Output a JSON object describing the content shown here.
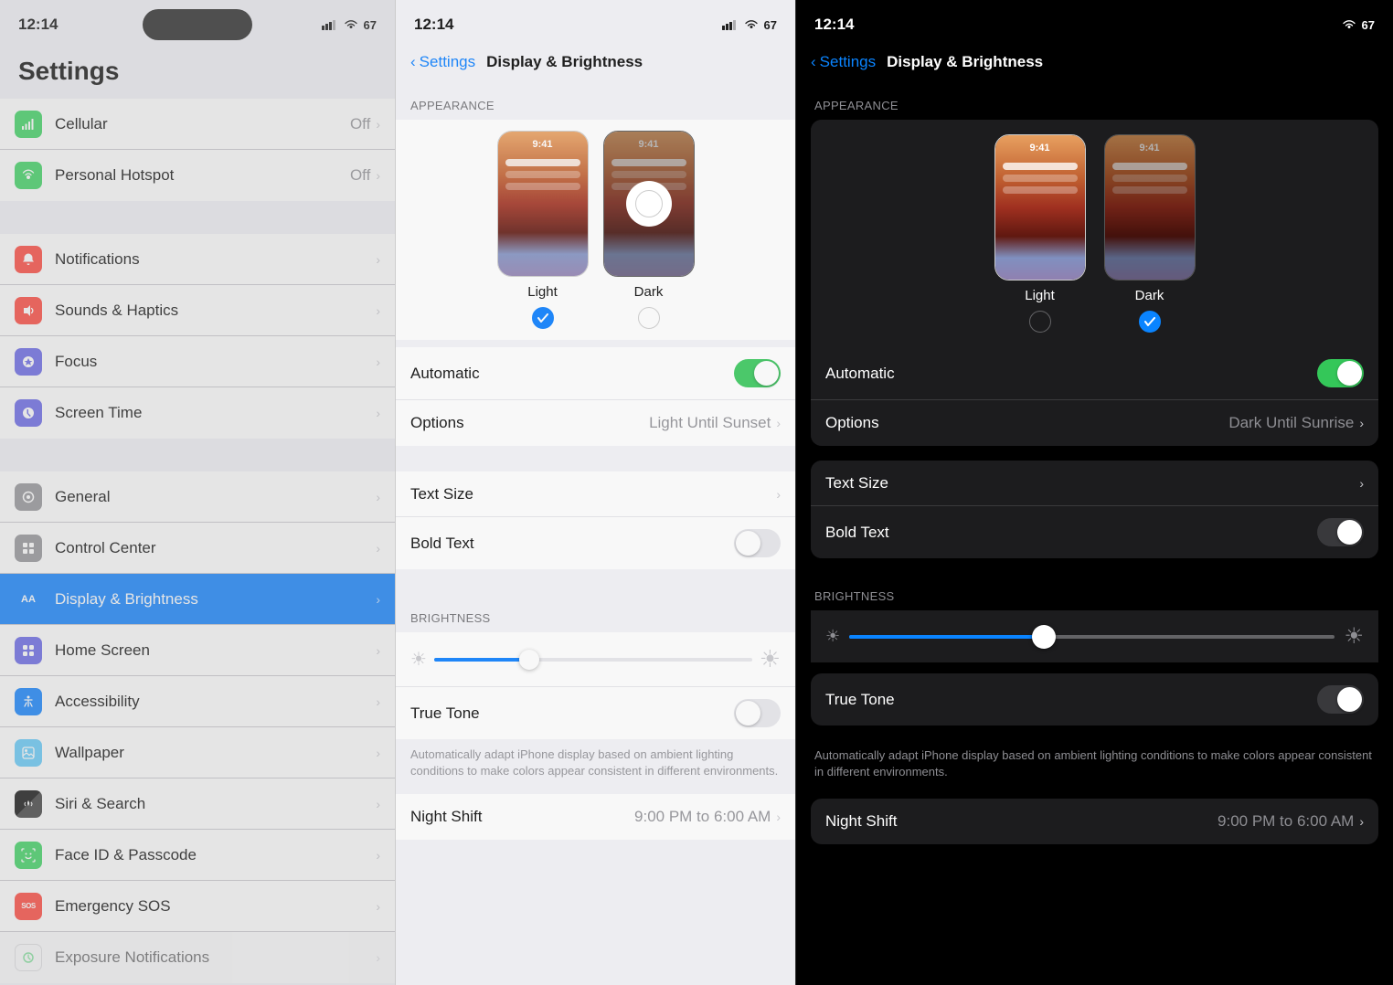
{
  "panel1": {
    "status_time": "12:14",
    "title": "Settings",
    "groups": [
      {
        "items": [
          {
            "id": "cellular",
            "label": "Cellular",
            "value": "Off",
            "icon_color": "#30d158",
            "icon_char": "📶"
          },
          {
            "id": "personal_hotspot",
            "label": "Personal Hotspot",
            "value": "Off",
            "icon_color": "#30d158",
            "icon_char": "🔗"
          }
        ]
      },
      {
        "items": [
          {
            "id": "notifications",
            "label": "Notifications",
            "value": "",
            "icon_color": "#ff3b30",
            "icon_char": "🔔"
          },
          {
            "id": "sounds",
            "label": "Sounds & Haptics",
            "value": "",
            "icon_color": "#ff3b30",
            "icon_char": "🔊"
          },
          {
            "id": "focus",
            "label": "Focus",
            "value": "",
            "icon_color": "#5e5ce6",
            "icon_char": "🌙"
          },
          {
            "id": "screen_time",
            "label": "Screen Time",
            "value": "",
            "icon_color": "#5e5ce6",
            "icon_char": "⏳"
          }
        ]
      },
      {
        "items": [
          {
            "id": "general",
            "label": "General",
            "value": "",
            "icon_color": "#8e8e93",
            "icon_char": "⚙"
          },
          {
            "id": "control_center",
            "label": "Control Center",
            "value": "",
            "icon_color": "#8e8e93",
            "icon_char": "🎛"
          },
          {
            "id": "display",
            "label": "Display & Brightness",
            "value": "",
            "icon_color": "#007aff",
            "icon_char": "AA",
            "selected": true
          },
          {
            "id": "home_screen",
            "label": "Home Screen",
            "value": "",
            "icon_color": "#5e5ce6",
            "icon_char": "⊞"
          },
          {
            "id": "accessibility",
            "label": "Accessibility",
            "value": "",
            "icon_color": "#007aff",
            "icon_char": "♿"
          },
          {
            "id": "wallpaper",
            "label": "Wallpaper",
            "value": "",
            "icon_color": "#5ac8fa",
            "icon_char": "🖼"
          },
          {
            "id": "siri",
            "label": "Siri & Search",
            "value": "",
            "icon_color": "#000",
            "icon_char": "🎤"
          },
          {
            "id": "faceid",
            "label": "Face ID & Passcode",
            "value": "",
            "icon_color": "#30d158",
            "icon_char": "👤"
          },
          {
            "id": "emergency_sos",
            "label": "Emergency SOS",
            "value": "",
            "icon_color": "#ff3b30",
            "icon_char": "SOS"
          },
          {
            "id": "exposure",
            "label": "Exposure Notifications",
            "value": "",
            "icon_color": "#fff",
            "icon_char": "🔔"
          }
        ]
      }
    ]
  },
  "panel2": {
    "status_time": "12:14",
    "nav_back": "Settings",
    "title": "Display & Brightness",
    "appearance_section": "APPEARANCE",
    "light_label": "Light",
    "dark_label": "Dark",
    "light_selected": true,
    "dark_selected": false,
    "automatic_label": "Automatic",
    "automatic_on": true,
    "options_label": "Options",
    "options_value": "Light Until Sunset",
    "text_size_label": "Text Size",
    "bold_text_label": "Bold Text",
    "bold_text_on": false,
    "brightness_section": "BRIGHTNESS",
    "true_tone_label": "True Tone",
    "true_tone_on": false,
    "true_tone_desc": "Automatically adapt iPhone display based on ambient lighting conditions to make colors appear consistent in different environments.",
    "night_shift_label": "Night Shift",
    "night_shift_value": "9:00 PM to 6:00 AM"
  },
  "panel3": {
    "status_time": "12:14",
    "nav_back": "Settings",
    "title": "Display & Brightness",
    "appearance_section": "APPEARANCE",
    "light_label": "Light",
    "dark_label": "Dark",
    "light_selected": false,
    "dark_selected": true,
    "automatic_label": "Automatic",
    "automatic_on": true,
    "options_label": "Options",
    "options_value": "Dark Until Sunrise",
    "text_size_label": "Text Size",
    "bold_text_label": "Bold Text",
    "bold_text_on": false,
    "brightness_section": "BRIGHTNESS",
    "true_tone_label": "True Tone",
    "true_tone_on": false,
    "true_tone_desc": "Automatically adapt iPhone display based on ambient lighting conditions to make colors appear consistent in different environments.",
    "night_shift_label": "Night Shift",
    "night_shift_value": "9:00 PM to 6:00 AM"
  }
}
